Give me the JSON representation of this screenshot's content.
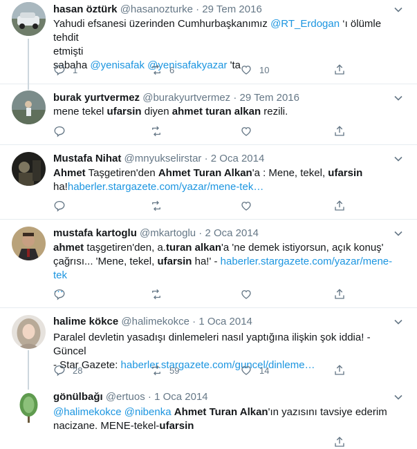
{
  "tweets": [
    {
      "name": "hasan öztürk",
      "handle": "@hasanozturke",
      "date": "29 Tem 2016",
      "line1_pre": "Yahudi efsanesi üzerinden Cumhurbaşkanımız ",
      "line1_mention": "@RT_Erdogan",
      "line1_post": " ‘ı ölümle tehdit",
      "line2": "etmişti",
      "line3_pre": "sabaha ",
      "line3_mention1": "@yenisafak",
      "line3_space": " ",
      "line3_mention2": "@yenisafakyazar",
      "line3_post": " 'ta",
      "replies": "1",
      "retweets": "6",
      "likes": "10"
    },
    {
      "name": "burak yurtvermez",
      "handle": "@burakyurtvermez",
      "date": "29 Tem 2016",
      "t1": "mene tekel ",
      "t2": "ufarsin",
      "t3": " diyen ",
      "t4": "ahmet turan alkan",
      "t5": " rezili."
    },
    {
      "name": "Mustafa Nihat",
      "handle": "@mnyukselirstar",
      "date": "2 Oca 2014",
      "t1": "Ahmet",
      "t2": " Taşgetiren'den ",
      "t3": "Ahmet Turan Alkan",
      "t4": "'a : Mene, tekel, ",
      "t5": "ufarsin",
      "t6": "ha!",
      "link": "haberler.stargazete.com/yazar/mene-tek…"
    },
    {
      "name": "mustafa kartoglu",
      "handle": "@mkartoglu",
      "date": "2 Oca 2014",
      "t1": "ahmet",
      "t2": " taşgetiren'den, a.",
      "t3": "turan alkan",
      "t4": "'a 'ne demek istiyorsun, açık konuş'",
      "t5": "çağrısı... 'Mene, tekel, ",
      "t6": "ufarsin",
      "t7": " ha!' - ",
      "link": "haberler.stargazete.com/yazar/mene-tek",
      "link2": "…"
    },
    {
      "name": "halime kökce",
      "handle": "@halimekokce",
      "date": "1 Oca 2014",
      "line1": "Paralel devletin yasadışı dinlemeleri nasıl yaptığına ilişkin şok iddia! - Güncel",
      "line2_pre": "- Star Gazete: ",
      "link": "haberler.stargazete.com/guncel/dinleme…",
      "replies": "28",
      "retweets": "59",
      "likes": "14"
    },
    {
      "name": "gönülbağı",
      "handle": "@ertuos",
      "date": "1 Oca 2014",
      "m1": "@halimekokce",
      "sp": " ",
      "m2": "@nibenka",
      "t1": " ",
      "t2": "Ahmet Turan Alkan",
      "t3": "'ın yazısını tavsiye ederim",
      "t4": "nacizane. MENE-tekel-",
      "t5": "ufarsin"
    }
  ],
  "separator": "·",
  "icons": [
    "reply-icon",
    "retweet-icon",
    "like-icon",
    "share-icon",
    "chevron-down-icon"
  ],
  "colors": {
    "text": "#14171a",
    "secondary": "#657786",
    "link": "#1b95e0",
    "border": "#e6ecf0"
  }
}
